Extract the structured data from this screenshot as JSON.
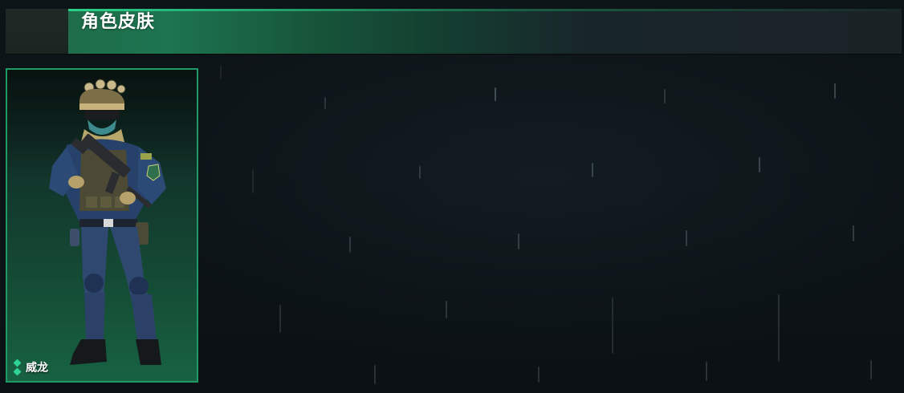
{
  "header": {
    "title": "角色皮肤"
  },
  "skins": [
    {
      "name": "威龙",
      "selected": true,
      "icon": "character-portrait"
    }
  ],
  "colors": {
    "accent": "#2fd495",
    "card_border": "#1f9a67",
    "header_band": "#1d7450",
    "background": "#0c1216"
  }
}
